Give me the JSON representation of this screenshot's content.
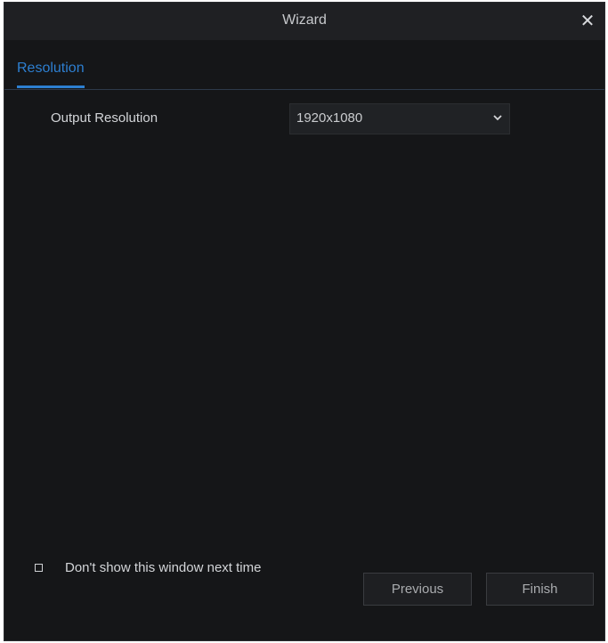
{
  "window": {
    "title": "Wizard",
    "close_icon": "close-icon"
  },
  "tabs": [
    {
      "label": "Resolution",
      "active": true
    }
  ],
  "form": {
    "output_resolution_label": "Output Resolution",
    "output_resolution_value": "1920x1080"
  },
  "footer": {
    "dont_show_label": "Don't show this window next time",
    "dont_show_checked": false,
    "previous_label": "Previous",
    "finish_label": "Finish"
  },
  "colors": {
    "background": "#151618",
    "titlebar": "#1f2023",
    "accent": "#2d7fd1",
    "text": "#d3d5d8"
  }
}
